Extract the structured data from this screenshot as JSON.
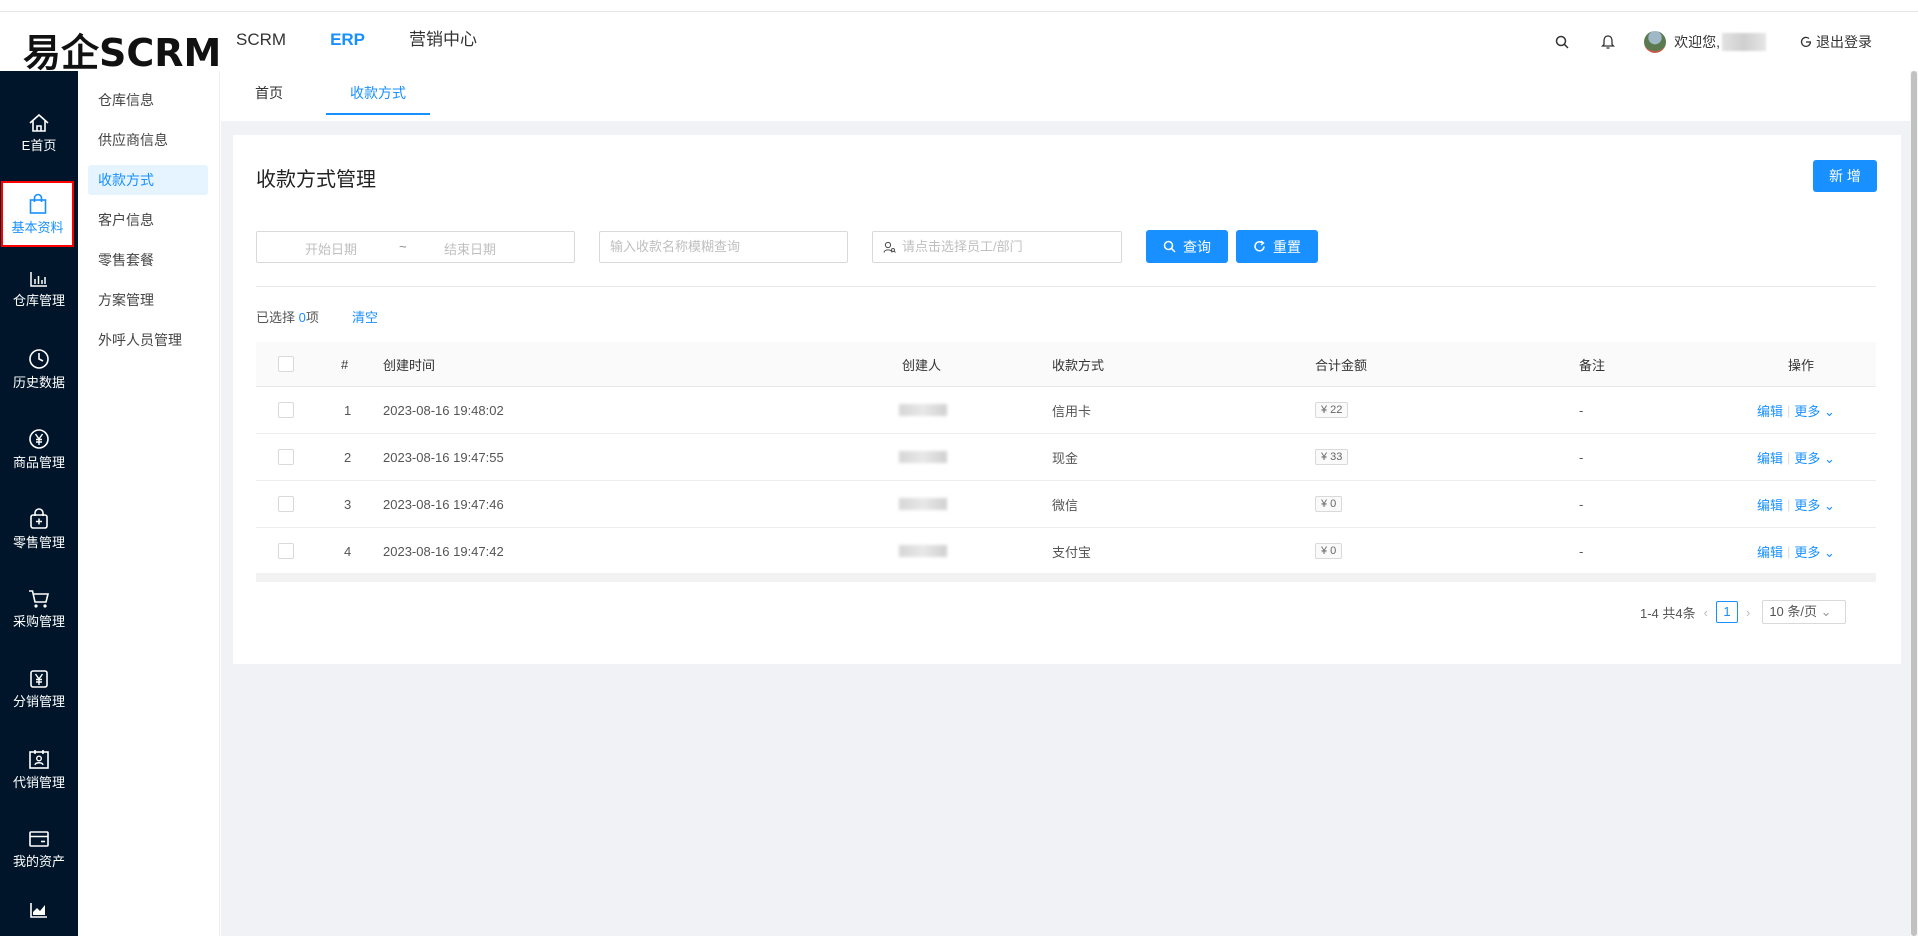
{
  "header": {
    "logo": "易企SCRM",
    "nav": [
      "SCRM",
      "ERP",
      "营销中心"
    ],
    "active_nav": "ERP",
    "welcome": "欢迎您,",
    "logout": "退出登录"
  },
  "sidebar": {
    "items": [
      {
        "label": "E首页",
        "icon": "home-icon"
      },
      {
        "label": "基本资料",
        "icon": "shopping-bag-icon"
      },
      {
        "label": "仓库管理",
        "icon": "bar-chart-icon"
      },
      {
        "label": "历史数据",
        "icon": "clock-icon"
      },
      {
        "label": "商品管理",
        "icon": "yen-circle-icon"
      },
      {
        "label": "零售管理",
        "icon": "bag-plus-icon"
      },
      {
        "label": "采购管理",
        "icon": "cart-icon"
      },
      {
        "label": "分销管理",
        "icon": "yen-box-icon"
      },
      {
        "label": "代销管理",
        "icon": "calendar-user-icon"
      },
      {
        "label": "我的资产",
        "icon": "wallet-icon"
      },
      {
        "label": "",
        "icon": "area-chart-icon"
      }
    ],
    "active_index": 1
  },
  "submenu": {
    "items": [
      "仓库信息",
      "供应商信息",
      "收款方式",
      "客户信息",
      "零售套餐",
      "方案管理",
      "外呼人员管理"
    ],
    "active_index": 2
  },
  "tabs": [
    "首页",
    "收款方式"
  ],
  "main": {
    "title": "收款方式管理",
    "add_button": "新 增",
    "filters": {
      "start_date_placeholder": "开始日期",
      "tilde": "~",
      "end_date_placeholder": "结束日期",
      "name_placeholder": "输入收款名称模糊查询",
      "staff_placeholder": "请点击选择员工/部门",
      "search_button": "查询",
      "reset_button": "重置"
    },
    "selection": {
      "prefix": "已选择",
      "count": "0",
      "suffix": "项",
      "clear": "清空"
    }
  },
  "table": {
    "columns": [
      "#",
      "创建时间",
      "创建人",
      "收款方式",
      "合计金额",
      "备注",
      "操作"
    ],
    "rows": [
      {
        "index": "1",
        "created": "2023-08-16 19:48:02",
        "method": "信用卡",
        "amount": "¥ 22",
        "remark": "-"
      },
      {
        "index": "2",
        "created": "2023-08-16 19:47:55",
        "method": "现金",
        "amount": "¥ 33",
        "remark": "-"
      },
      {
        "index": "3",
        "created": "2023-08-16 19:47:46",
        "method": "微信",
        "amount": "¥ 0",
        "remark": "-"
      },
      {
        "index": "4",
        "created": "2023-08-16 19:47:42",
        "method": "支付宝",
        "amount": "¥ 0",
        "remark": "-"
      }
    ],
    "op_edit": "编辑",
    "op_more": "更多"
  },
  "pagination": {
    "summary": "1-4 共4条",
    "current_page": "1",
    "page_size": "10 条/页"
  },
  "colors": {
    "primary": "#1890ff",
    "sidebar_bg": "#001529",
    "content_bg": "#f0f2f5"
  }
}
